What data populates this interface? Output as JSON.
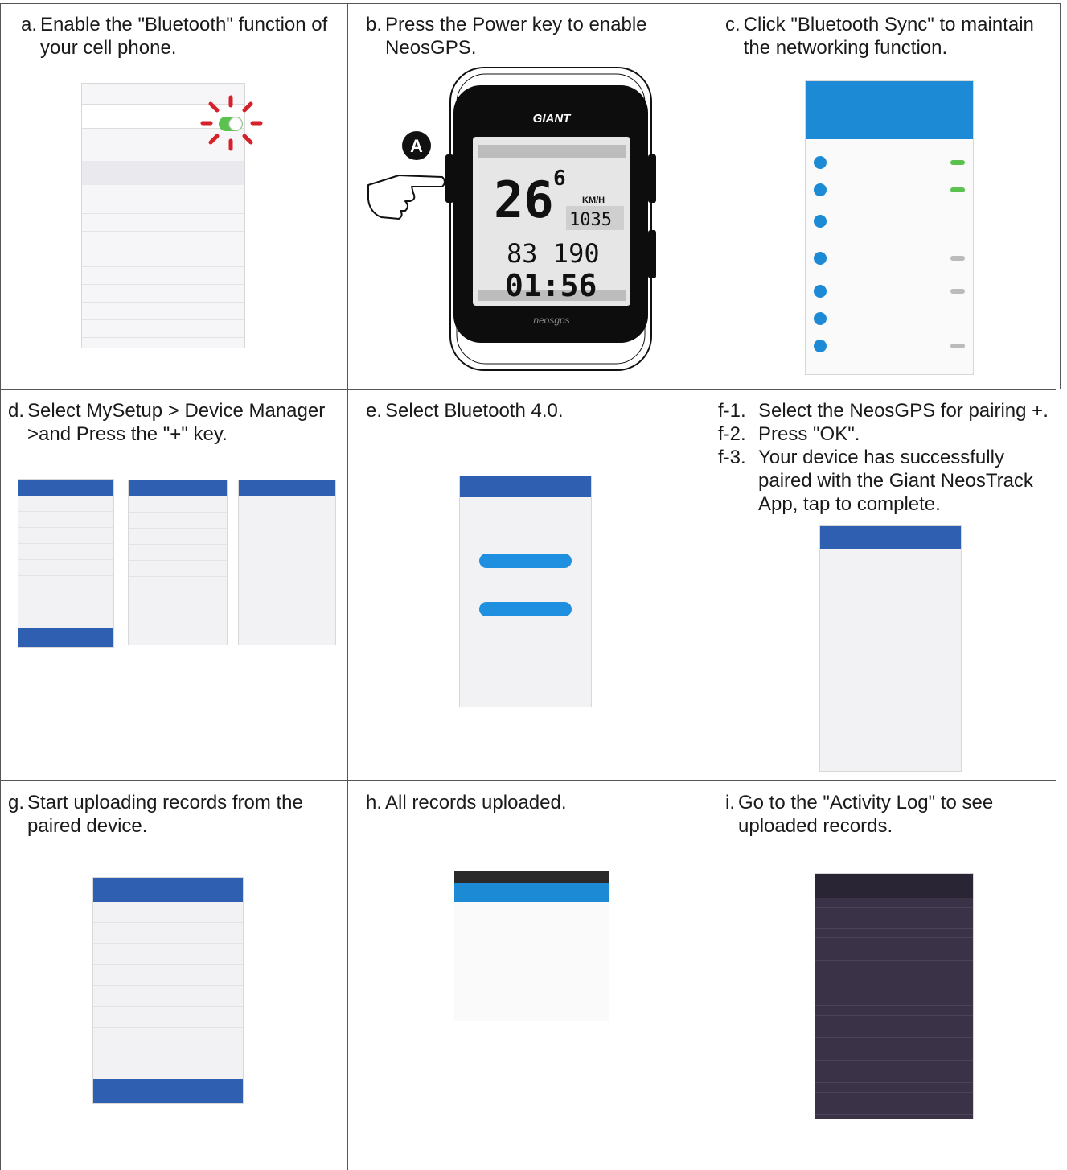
{
  "steps": {
    "a": {
      "label": "a.",
      "text": "Enable the \"Bluetooth\" function of your cell phone."
    },
    "b": {
      "label": "b.",
      "text": "Press the Power key to enable NeosGPS."
    },
    "c": {
      "label": "c.",
      "text": "Click \"Bluetooth Sync\" to maintain the networking function."
    },
    "d": {
      "label": "d.",
      "text": "Select MySetup > Device Manager >and Press the \"+\" key."
    },
    "e": {
      "label": "e.",
      "text": "Select Bluetooth 4.0."
    },
    "f": [
      {
        "label": "f-1.",
        "text": "Select the NeosGPS for pairing +."
      },
      {
        "label": "f-2.",
        "text": "Press \"OK\"."
      },
      {
        "label": "f-3.",
        "text": "Your device has successfully paired with the Giant NeosTrack App, tap to complete."
      }
    ],
    "g": {
      "label": "g.",
      "text": "Start uploading records from the paired device."
    },
    "h": {
      "label": "h.",
      "text": "All records uploaded."
    },
    "i": {
      "label": "i.",
      "text": "Go to the \"Activity Log\" to see uploaded records."
    }
  },
  "device": {
    "key_letter": "A",
    "brand": "GIANT",
    "speed": "26",
    "speed_decimal": "6",
    "unit": "KM/H",
    "altitude": "1035",
    "distance": "83 190",
    "time": "01:56",
    "model": "neosgps"
  },
  "colors": {
    "accent_blue": "#2f5fb1",
    "android_blue": "#1d8ad6",
    "bluetooth_red": "#d6202a",
    "device_body": "#0d0d0d",
    "grid_line": "#555555"
  }
}
